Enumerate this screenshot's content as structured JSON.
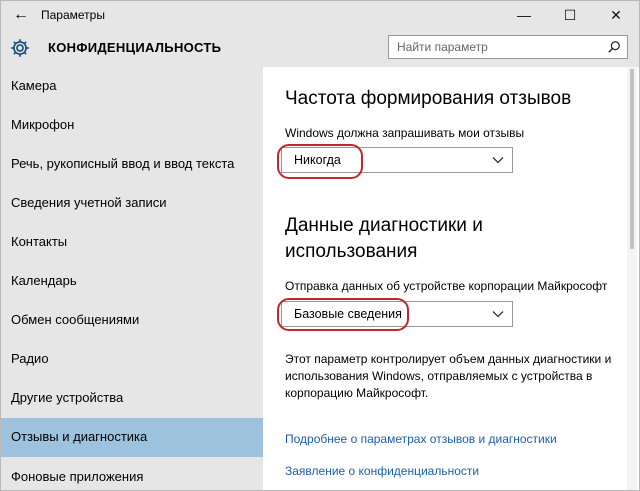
{
  "window": {
    "title": "Параметры",
    "back_glyph": "←",
    "min_glyph": "—",
    "max_glyph": "☐",
    "close_glyph": "✕"
  },
  "header": {
    "title": "КОНФИДЕНЦИАЛЬНОСТЬ",
    "search_placeholder": "Найти параметр"
  },
  "sidebar": {
    "items": [
      {
        "label": "Камера"
      },
      {
        "label": "Микрофон"
      },
      {
        "label": "Речь, рукописный ввод и ввод текста"
      },
      {
        "label": "Сведения учетной записи"
      },
      {
        "label": "Контакты"
      },
      {
        "label": "Календарь"
      },
      {
        "label": "Обмен сообщениями"
      },
      {
        "label": "Радио"
      },
      {
        "label": "Другие устройства"
      },
      {
        "label": "Отзывы и диагностика",
        "selected": true
      },
      {
        "label": "Фоновые приложения"
      }
    ]
  },
  "main": {
    "feedback": {
      "heading": "Частота формирования отзывов",
      "label": "Windows должна запрашивать мои отзывы",
      "value": "Никогда"
    },
    "diagnostics": {
      "heading_line1": "Данные диагностики и",
      "heading_line2": "использования",
      "label": "Отправка данных об устройстве корпорации Майкрософт",
      "value": "Базовые сведения",
      "desc_line1": "Этот параметр контролирует объем данных диагностики и",
      "desc_line2": "использования Windows, отправляемых с устройства в",
      "desc_line3": "корпорацию Майкрософт."
    },
    "links": {
      "more": "Подробнее о параметрах отзывов и диагностики",
      "privacy": "Заявление о конфиденциальности"
    }
  },
  "colors": {
    "accent_selected": "#9dc2de",
    "link": "#1c5fa8",
    "highlight": "#c1272d",
    "sidebar_bg": "#e6e6e6"
  }
}
